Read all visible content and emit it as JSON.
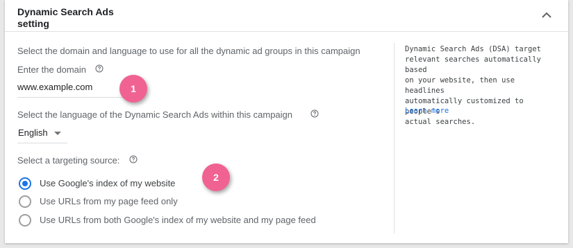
{
  "header": {
    "title_line1": "Dynamic Search Ads",
    "title_line2": "setting"
  },
  "domain_section": {
    "intro": "Select the domain and language to use for all the dynamic ad groups in this campaign",
    "label": "Enter the domain",
    "value": "www.example.com",
    "help_icon": "help-circle-icon"
  },
  "language_section": {
    "label": "Select the language of the Dynamic Search Ads within this campaign",
    "selected": "English",
    "help_icon": "help-circle-icon"
  },
  "targeting_section": {
    "label": "Select a targeting source:",
    "help_icon": "help-circle-icon",
    "options": [
      {
        "label": "Use Google's index of my website",
        "checked": true
      },
      {
        "label": "Use URLs from my page feed only",
        "checked": false
      },
      {
        "label": "Use URLs from both Google's index of my website and my page feed",
        "checked": false
      }
    ]
  },
  "sidebar": {
    "description": "Dynamic Search Ads (DSA) target\nrelevant searches automatically based\non your website, then use headlines\nautomatically customized to people's\nactual searches.",
    "learn_more": "Learn more"
  },
  "annotations": [
    {
      "label": "1"
    },
    {
      "label": "2"
    }
  ],
  "colors": {
    "accent": "#1a73e8",
    "badge": "#f06292",
    "text_secondary": "#5f6368",
    "text_primary": "#202124",
    "disabled_text": "#5f6368"
  }
}
